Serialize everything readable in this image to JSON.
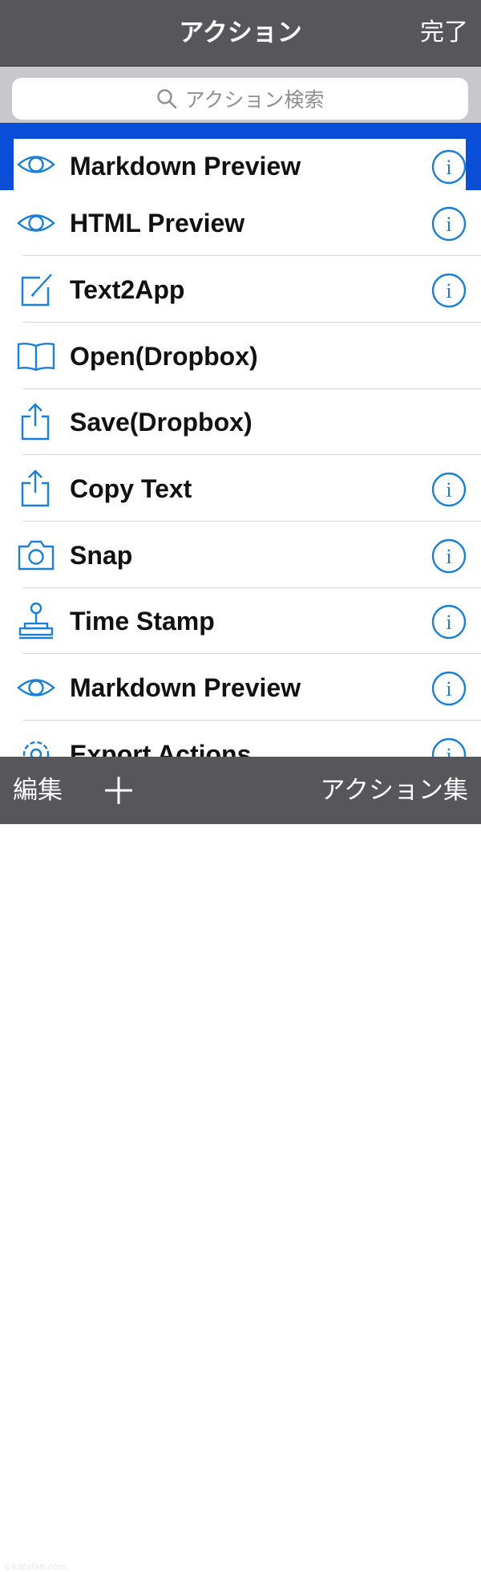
{
  "navbar": {
    "title": "アクション",
    "done": "完了"
  },
  "search": {
    "placeholder": "アクション検索"
  },
  "actions": [
    {
      "label": "Markdown Preview",
      "icon": "eye-icon",
      "info": true,
      "selected": true
    },
    {
      "label": "HTML Preview",
      "icon": "eye-icon",
      "info": true
    },
    {
      "label": "Text2App",
      "icon": "compose-icon",
      "info": true
    },
    {
      "label": "Open(Dropbox)",
      "icon": "book-icon",
      "info": false
    },
    {
      "label": "Save(Dropbox)",
      "icon": "share-icon",
      "info": false
    },
    {
      "label": "Copy Text",
      "icon": "share-icon",
      "info": true
    },
    {
      "label": "Snap",
      "icon": "camera-icon",
      "info": true
    },
    {
      "label": "Time Stamp",
      "icon": "stamp-icon",
      "info": true
    },
    {
      "label": "Markdown Preview",
      "icon": "eye-icon",
      "info": true
    },
    {
      "label": "Export Actions",
      "icon": "gear-icon",
      "info": true
    }
  ],
  "toolbar": {
    "edit": "編集",
    "add": "+",
    "action_set": "アクション集"
  },
  "watermark": "©katalab.com",
  "colors": {
    "accent": "#1a7fd6",
    "bar": "#57565b",
    "selection": "#0a4ed8"
  }
}
